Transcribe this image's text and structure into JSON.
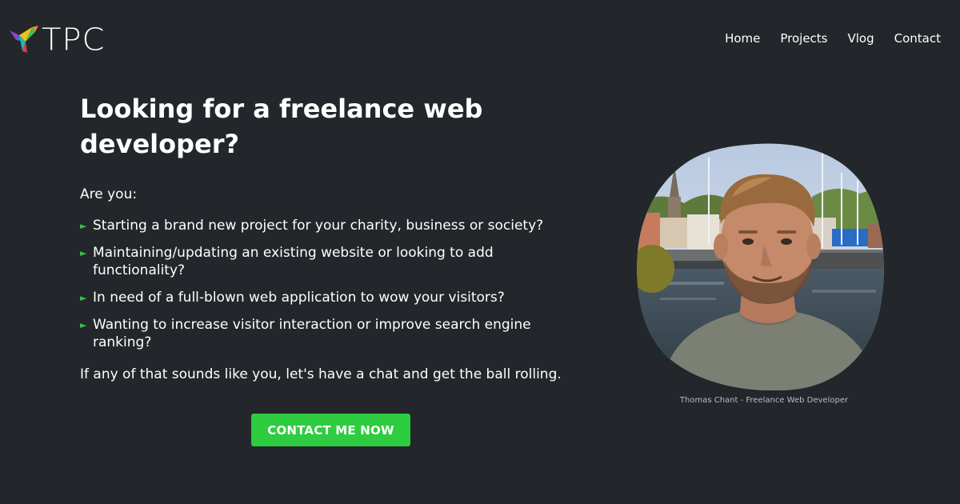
{
  "header": {
    "logo_text": "TPC",
    "nav": [
      {
        "label": "Home"
      },
      {
        "label": "Projects"
      },
      {
        "label": "Vlog"
      },
      {
        "label": "Contact"
      }
    ]
  },
  "hero": {
    "headline": "Looking for a freelance web developer?",
    "intro": "Are you:",
    "bullets": [
      "Starting a brand new project for your charity, business or society?",
      "Maintaining/updating an existing website or looking to add functionality?",
      "In need of a full-blown web application to wow your visitors?",
      "Wanting to increase visitor interaction or improve search engine ranking?"
    ],
    "bullet_marker": "►",
    "outro": "If any of that sounds like you, let's have a chat and get the ball rolling.",
    "cta_label": "CONTACT ME NOW"
  },
  "portrait": {
    "caption": "Thomas Chant - Freelance Web Developer"
  },
  "colors": {
    "background": "#23262a",
    "accent": "#2ecc40",
    "text": "#ffffff",
    "caption": "#b9bcc0"
  }
}
